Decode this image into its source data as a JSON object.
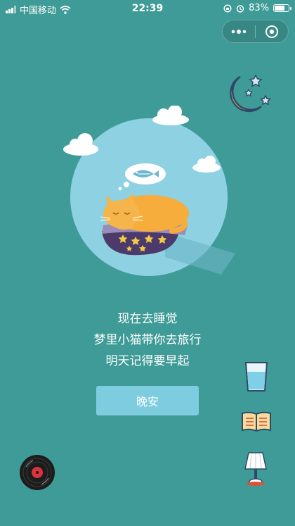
{
  "status_bar": {
    "carrier": "中国移动",
    "time": "22:39",
    "battery_percent_text": "83%",
    "battery_level": 0.83
  },
  "capsule": {
    "more_icon": "more-dots-icon",
    "close_icon": "target-circle-icon"
  },
  "message": {
    "line1": "现在去睡觉",
    "line2": "梦里小猫带你去旅行",
    "line3": "明天记得要早起"
  },
  "button": {
    "label": "晚安"
  },
  "icons": {
    "moon": "moon-stars-icon",
    "water": "water-glass-icon",
    "book": "open-book-icon",
    "lamp": "table-lamp-icon",
    "record": "vinyl-record-icon"
  },
  "colors": {
    "background": "#3f9b97",
    "circle": "#8dd1e2",
    "button": "#7ecce0",
    "cat": "#f6ad3c",
    "cushion": "#4b3a6b",
    "pillow": "#9b8cb8",
    "star": "#f6c944"
  }
}
